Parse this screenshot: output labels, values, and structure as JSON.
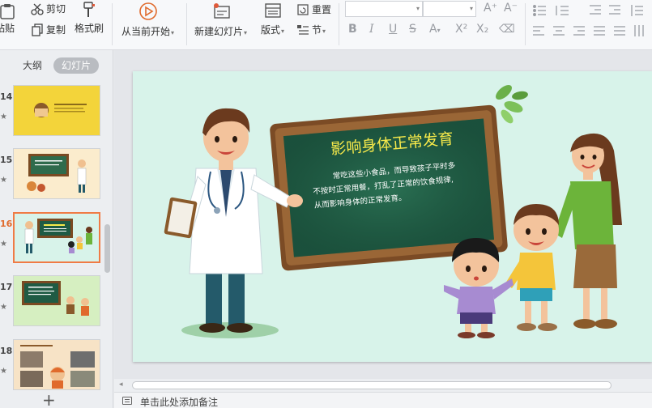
{
  "ribbon": {
    "paste_label": "粘贴",
    "cut_label": "剪切",
    "copy_label": "复制",
    "format_painter_label": "格式刷",
    "from_current_label": "从当前开始",
    "new_slide_label": "新建幻灯片",
    "layout_label": "版式",
    "reset_label": "重置",
    "section_label": "节"
  },
  "left_pane": {
    "tabs": [
      {
        "label": "大纲",
        "active": false
      },
      {
        "label": "幻灯片",
        "active": true
      }
    ],
    "thumbnails": [
      {
        "number": "14",
        "current": false
      },
      {
        "number": "15",
        "current": false
      },
      {
        "number": "16",
        "current": true
      },
      {
        "number": "17",
        "current": false
      },
      {
        "number": "18",
        "current": false
      }
    ]
  },
  "slide": {
    "title": "影响身体正常发育",
    "body_lines": [
      "常吃这些小食品，而导致孩子平时多",
      "不按时正常用餐，打乱了正常的饮食规律,",
      "从而影响身体的正常发育。"
    ]
  },
  "notes": {
    "placeholder": "单击此处添加备注"
  },
  "colors": {
    "accent_orange": "#f07b45",
    "slide_bg": "#d8f3ea",
    "chalkboard": "#1f5b44",
    "title_yellow": "#f6e94a"
  }
}
